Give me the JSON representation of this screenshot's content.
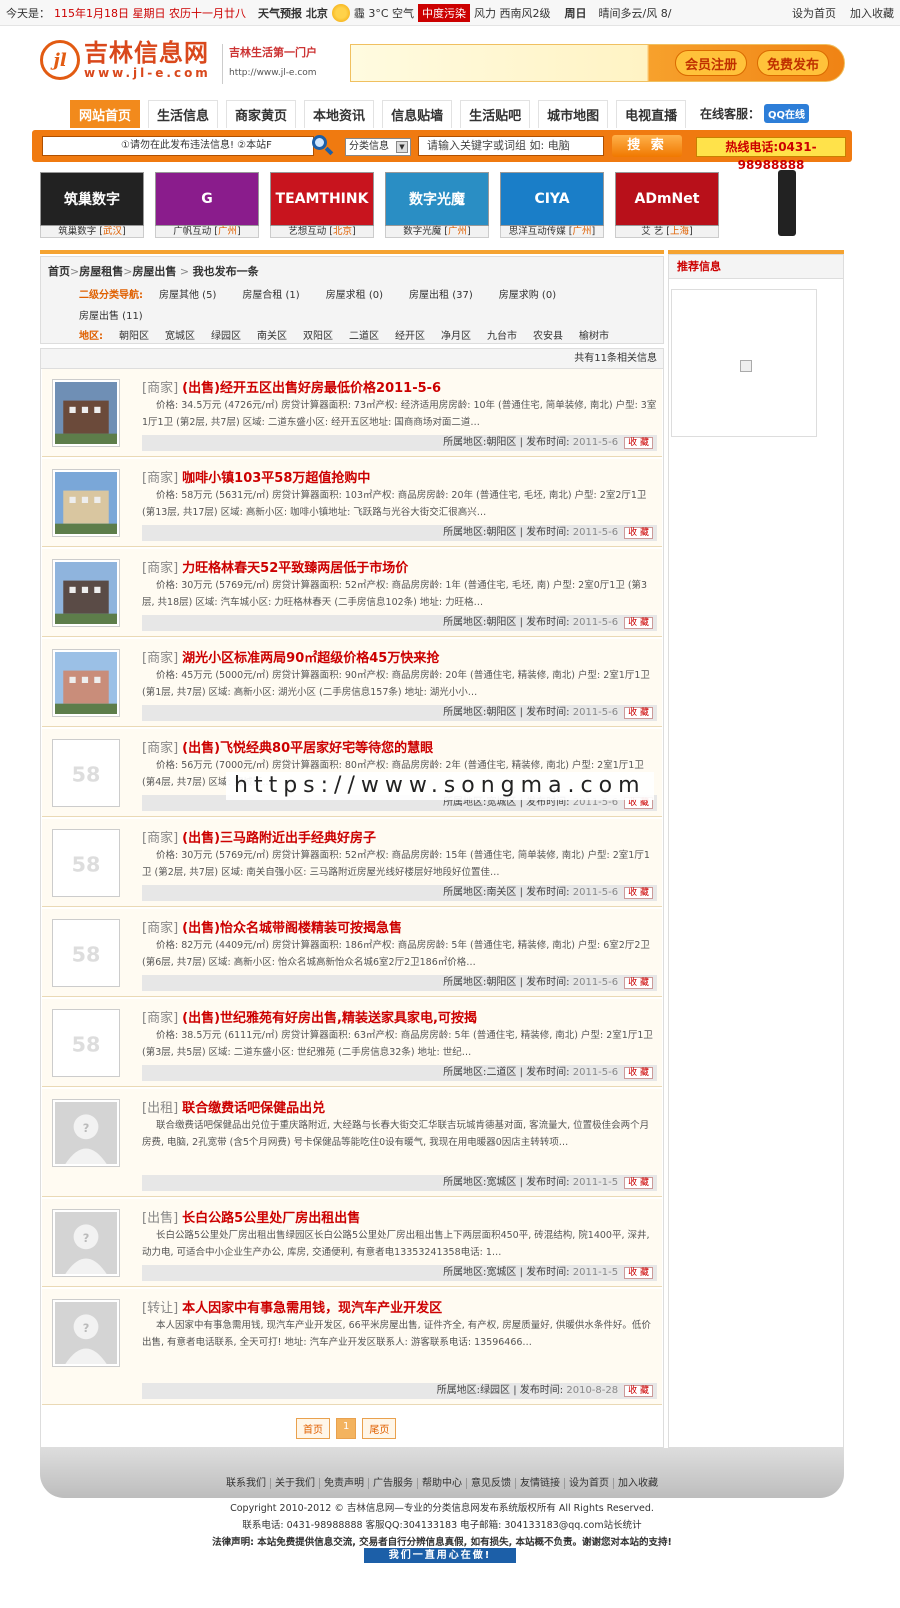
{
  "topbar": {
    "today_label": "今天是：",
    "date": "115年1月18日 星期日 农历十一月廿八",
    "weather": "天气预报 北京",
    "temp": "霾 3°C 空气",
    "aqi": "中度污染",
    "wind": "风力 西南风2级",
    "week": "周日",
    "more": "晴间多云/风 8/",
    "set_home": "设为首页",
    "add_fav": "加入收藏"
  },
  "header": {
    "logo_mark": "jl",
    "site_name": "吉林信息网",
    "site_url_text": "www.jl-e.com",
    "slogan": "吉林生活第一门户",
    "url": "http://www.jl-e.com",
    "register": "会员注册",
    "post": "免费发布"
  },
  "nav": {
    "items": [
      "网站首页",
      "生活信息",
      "商家黄页",
      "本地资讯",
      "信息贴墙",
      "生活贴吧",
      "城市地图",
      "电视直播"
    ],
    "kefu_label": "在线客服：",
    "qq": "QQ在线"
  },
  "search": {
    "notice": "①请勿在此发布违法信息! ②本站F",
    "category": "分类信息",
    "placeholder": "请输入关键字或词组 如: 电脑",
    "button": "搜 索",
    "hotline": "热线电话:0431-98988888"
  },
  "partners": [
    {
      "banner": "筑巢数字",
      "name": "筑巢数字",
      "city": "武汉",
      "color": "#222"
    },
    {
      "banner": "G",
      "name": "广帆互动",
      "city": "广州",
      "color": "#8a1c8c"
    },
    {
      "banner": "TEAMTHINK",
      "name": "艺想互动",
      "city": "北京",
      "color": "#c8141e"
    },
    {
      "banner": "数字光魔",
      "name": "数字光魔",
      "city": "广州",
      "color": "#2a8ec4"
    },
    {
      "banner": "CIYA",
      "name": "思洋互动传媒",
      "city": "广州",
      "color": "#1a7ec8"
    },
    {
      "banner": "ADmNet",
      "name": "艾 艺",
      "city": "上海",
      "color": "#b8101a"
    }
  ],
  "filter": {
    "breadcrumb": [
      "首页",
      "房屋租售",
      "房屋出售",
      "我也发布一条"
    ],
    "cat_label": "二级分类导航:",
    "cats": [
      "房屋其他 (5)",
      "房屋合租 (1)",
      "房屋求租 (0)",
      "房屋出租 (37)",
      "房屋求购 (0)",
      "房屋出售 (11)"
    ],
    "area_label": "地区:",
    "areas": [
      "朝阳区",
      "宽城区",
      "绿园区",
      "南关区",
      "双阳区",
      "二道区",
      "经开区",
      "净月区",
      "九台市",
      "农安县",
      "榆树市"
    ]
  },
  "list": {
    "count_text": "共有11条相关信息",
    "area_label": "所属地区:",
    "time_label": "发布时间:",
    "fav": "收 藏",
    "items": [
      {
        "tag": "[商家]",
        "title": "(出售)经开五区出售好房最低价格2011-5-6",
        "desc": "价格: 34.5万元 (4726元/㎡) 房贷计算器面积: 73㎡产权: 经济适用房房龄: 10年 (普通住宅, 简单装修, 南北) 户型: 3室1厅1卫 (第2层, 共7层) 区域: 二道东盛小区: 经开五区地址: 国商商场对面二道…",
        "area": "朝阳区",
        "date": "2011-5-6",
        "thumb": "house"
      },
      {
        "tag": "[商家]",
        "title": "咖啡小镇103平58万超值抢购中",
        "desc": "价格: 58万元 (5631元/㎡) 房贷计算器面积: 103㎡产权: 商品房房龄: 20年 (普通住宅, 毛坯, 南北) 户型: 2室2厅1卫 (第13层, 共17层) 区域: 高新小区: 咖啡小镇地址: 飞跃路与光谷大街交汇很高兴…",
        "area": "朝阳区",
        "date": "2011-5-6",
        "thumb": "tower"
      },
      {
        "tag": "[商家]",
        "title": "力旺格林春天52平致臻两居低于市场价",
        "desc": "价格: 30万元 (5769元/㎡) 房贷计算器面积: 52㎡产权: 商品房房龄: 1年 (普通住宅, 毛坯, 南) 户型: 2室0厅1卫 (第3层, 共18层) 区域: 汽车城小区: 力旺格林春天 (二手房信息102条) 地址: 力旺格…",
        "area": "朝阳区",
        "date": "2011-5-6",
        "thumb": "build"
      },
      {
        "tag": "[商家]",
        "title": "湖光小区标准两局90㎡超级价格45万快来抢",
        "desc": "价格: 45万元 (5000元/㎡) 房贷计算器面积: 90㎡产权: 商品房房龄: 20年 (普通住宅, 精装修, 南北) 户型: 2室1厅1卫 (第1层, 共7层) 区域: 高新小区: 湖光小区 (二手房信息157条) 地址: 湖光小小…",
        "area": "朝阳区",
        "date": "2011-5-6",
        "thumb": "block"
      },
      {
        "tag": "[商家]",
        "title": "(出售)飞悦经典80平居家好宅等待您的慧眼",
        "desc": "价格: 56万元 (7000元/㎡) 房贷计算器面积: 80㎡产权: 商品房房龄: 2年 (普通住宅, 精装修, 南北) 户型: 2室1厅1卫 (第4层, 共7层) 区域: 宽城区…",
        "area": "宽城区",
        "date": "2011-5-6",
        "thumb": "58"
      },
      {
        "tag": "[商家]",
        "title": "(出售)三马路附近出手经典好房子",
        "desc": "价格: 30万元 (5769元/㎡) 房贷计算器面积: 52㎡产权: 商品房房龄: 15年 (普通住宅, 简单装修, 南北) 户型: 2室1厅1卫 (第2层, 共7层) 区域: 南关自强小区: 三马路附近房屋光线好楼层好地段好位置佳…",
        "area": "南关区",
        "date": "2011-5-6",
        "thumb": "58"
      },
      {
        "tag": "[商家]",
        "title": "(出售)怡众名城带阁楼精装可按揭急售",
        "desc": "价格: 82万元 (4409元/㎡) 房贷计算器面积: 186㎡产权: 商品房房龄: 5年 (普通住宅, 精装修, 南北) 户型: 6室2厅2卫 (第6层, 共7层) 区域: 高新小区: 怡众名城高新怡众名城6室2厅2卫186㎡价格…",
        "area": "朝阳区",
        "date": "2011-5-6",
        "thumb": "58"
      },
      {
        "tag": "[商家]",
        "title": "(出售)世纪雅苑有好房出售,精装送家具家电,可按揭",
        "desc": "价格: 38.5万元 (6111元/㎡) 房贷计算器面积: 63㎡产权: 商品房房龄: 5年 (普通住宅, 精装修, 南北) 户型: 2室1厅1卫 (第3层, 共5层) 区域: 二道东盛小区: 世纪雅苑 (二手房信息32条) 地址: 世纪…",
        "area": "二道区",
        "date": "2011-5-6",
        "thumb": "58"
      },
      {
        "tag": "[出租]",
        "title": "联合缴费话吧保健品出兑",
        "desc": "联合缴费话吧保健品出兑位于重庆路附近, 大经路与长春大街交汇华联吉玩城肯德基对面, 客流量大, 位置极佳会两个月房费, 电脑, 2孔宽带 (含5个月网费) 号卡保健品等能吃住0设有暖气, 我现在用电暖器0因店主转转项…",
        "area": "宽城区",
        "date": "2011-1-5",
        "thumb": "person"
      },
      {
        "tag": "[出售]",
        "title": "长白公路5公里处厂房出租出售",
        "desc": "长白公路5公里处厂房出租出售绿园区长白公路5公里处厂房出租出售上下两层面积450平, 砖混结构, 院1400平, 深井, 动力电, 可适合中小企业生产办公, 库房, 交通便利, 有意者电13353241358电话: 1…",
        "area": "宽城区",
        "date": "2011-1-5",
        "thumb": "person"
      },
      {
        "tag": "[转让]",
        "title": "本人因家中有事急需用钱，现汽车产业开发区",
        "desc": "本人因家中有事急需用钱, 现汽车产业开发区, 66平米房屋出售, 证件齐全, 有产权, 房屋质量好, 供暖供水条件好。低价出售, 有意者电话联系, 全天可打! 地址: 汽车产业开发区联系人: 游客联系电话: 13596466…",
        "area": "绿园区",
        "date": "2010-8-28",
        "thumb": "person"
      }
    ]
  },
  "pager": {
    "first": "首页",
    "current": "1",
    "last": "尾页"
  },
  "side": {
    "title": "推荐信息"
  },
  "footer": {
    "links": [
      "联系我们",
      "关于我们",
      "免责声明",
      "广告服务",
      "帮助中心",
      "意见反馈",
      "友情链接",
      "设为首页",
      "加入收藏"
    ],
    "copyright": "Copyright 2010-2012 © 吉林信息网—专业的分类信息网发布系统版权所有 All Rights Reserved.",
    "contact": "联系电话: 0431-98988888   客服QQ:304133183 电子邮箱: 304133183@qq.com站长统计",
    "legal": "法律声明: 本站免费提供信息交流, 交易者自行分辨信息真假, 如有损失, 本站概不负责。谢谢您对本站的支持!",
    "badge": "我们一直用心在做!"
  },
  "watermark": "https://www.songma.com"
}
